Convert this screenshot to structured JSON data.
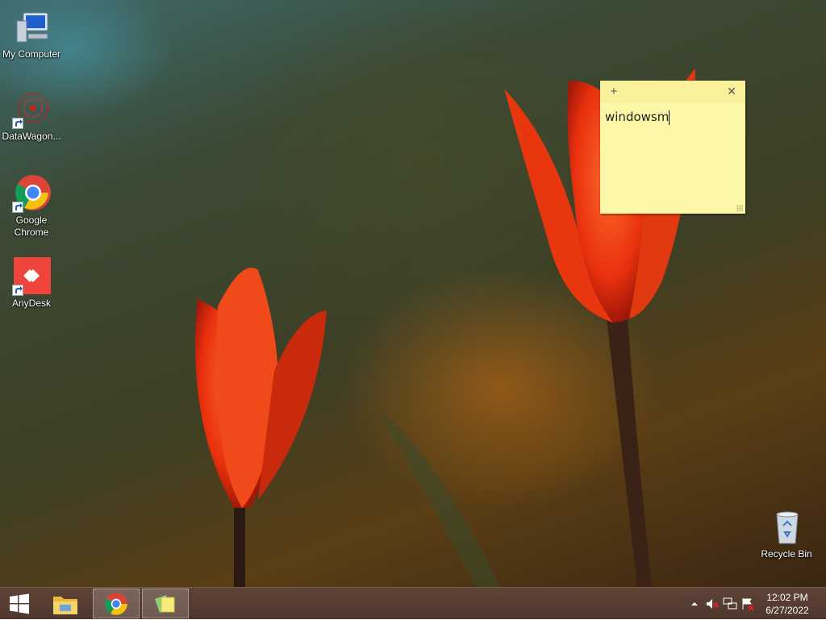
{
  "desktop_icons": [
    {
      "label": "My Computer",
      "icon": "computer-icon"
    },
    {
      "label": "DataWagon...",
      "icon": "datawagon-icon",
      "shortcut": true
    },
    {
      "label": "Google\nChrome",
      "icon": "chrome-icon",
      "shortcut": true
    },
    {
      "label": "AnyDesk",
      "icon": "anydesk-icon",
      "shortcut": true
    },
    {
      "label": "Recycle Bin",
      "icon": "recycle-bin-icon"
    }
  ],
  "sticky_note": {
    "text": "windowsm",
    "add_icon": "+",
    "close_icon": "✕",
    "color": "#fdf8a8"
  },
  "taskbar": {
    "buttons": [
      {
        "name": "start",
        "icon": "windows-logo-icon"
      },
      {
        "name": "file-explorer",
        "icon": "folder-icon"
      },
      {
        "name": "chrome",
        "icon": "chrome-icon"
      },
      {
        "name": "sticky-notes",
        "icon": "sticky-notes-icon"
      }
    ],
    "tray": {
      "time": "12:02 PM",
      "date": "6/27/2022",
      "icons": [
        "show-hidden-icons-icon",
        "volume-muted-icon",
        "network-icon",
        "action-center-flag-icon"
      ]
    }
  }
}
